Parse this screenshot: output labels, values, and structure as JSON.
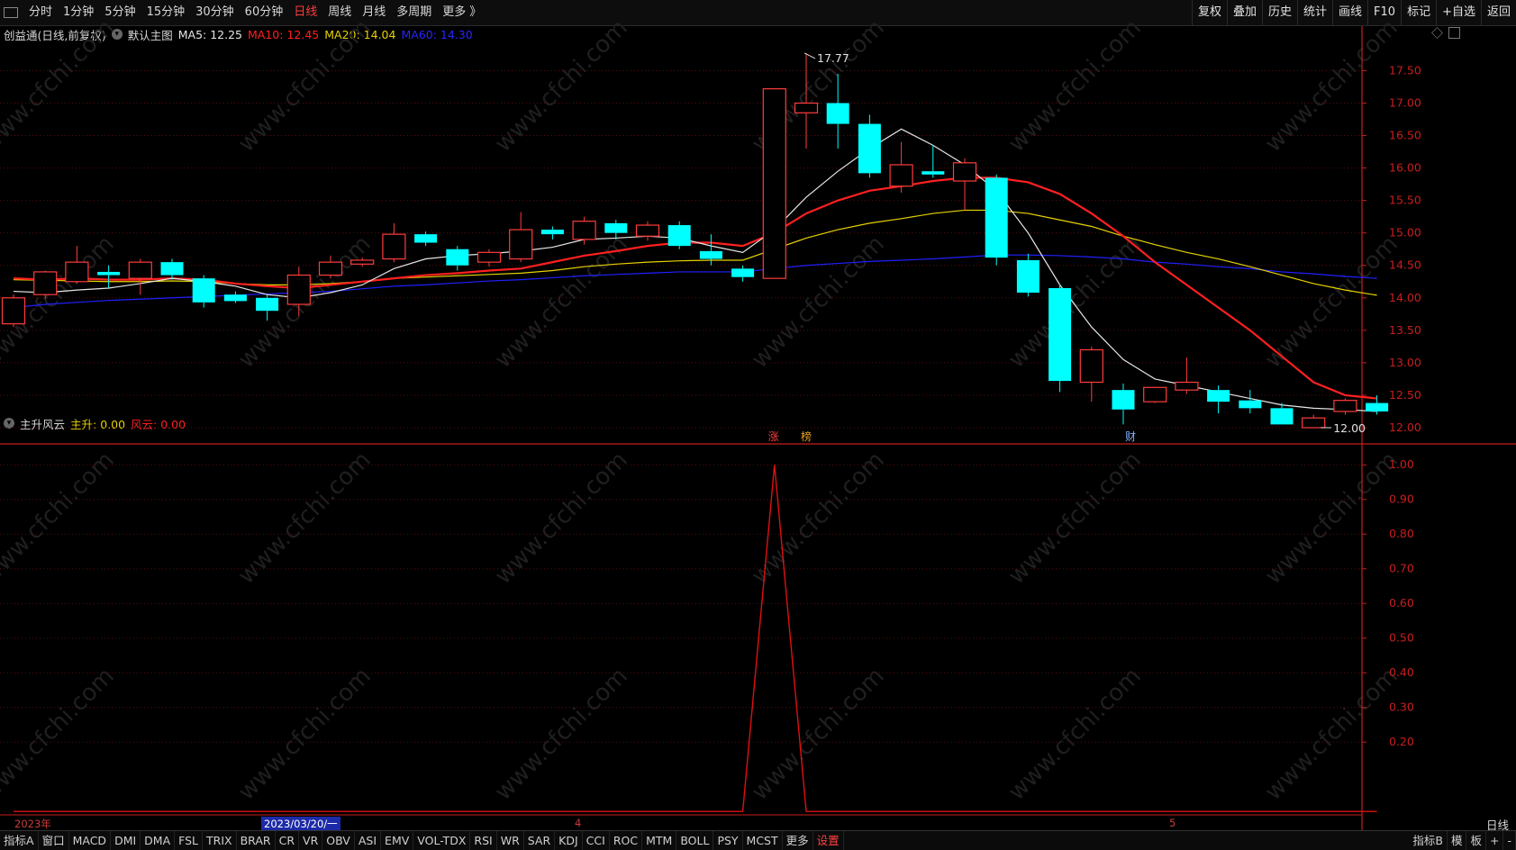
{
  "toolbar": {
    "left": [
      "分时",
      "1分钟",
      "5分钟",
      "15分钟",
      "30分钟",
      "60分钟",
      "日线",
      "周线",
      "月线",
      "多周期",
      "更多 》"
    ],
    "active": "日线",
    "right": [
      "复权",
      "叠加",
      "历史",
      "统计",
      "画线",
      "F10",
      "标记",
      "+自选",
      "返回"
    ]
  },
  "main_legend": {
    "title": "创益通(日线,前复权)",
    "template": "默认主图",
    "ma5": "MA5: 12.25",
    "ma10": "MA10: 12.45",
    "ma20": "MA20: 14.04",
    "ma60": "MA60: 14.30"
  },
  "indicator_legend": {
    "name": "主升风云",
    "s1": "主升: 0.00",
    "s2": "风云: 0.00"
  },
  "annotations": {
    "high": "17.77",
    "low": "12.00",
    "mark1": "涨",
    "mark2": "榜",
    "mark3": "财"
  },
  "dates": {
    "year": "2023年",
    "selected": "2023/03/20/一",
    "m4": "4",
    "m5": "5"
  },
  "period_label": "日线",
  "bottom": {
    "items": [
      "指标A",
      "窗口",
      "MACD",
      "DMI",
      "DMA",
      "FSL",
      "TRIX",
      "BRAR",
      "CR",
      "VR",
      "OBV",
      "ASI",
      "EMV",
      "VOL-TDX",
      "RSI",
      "WR",
      "SAR",
      "KDJ",
      "CCI",
      "ROC",
      "MTM",
      "BOLL",
      "PSY",
      "MCST",
      "更多",
      "设置"
    ],
    "right": [
      "指标B",
      "模",
      "板",
      "+",
      "-"
    ]
  },
  "watermark": "www.cfchi.com",
  "colors": {
    "up": "#ff3c3c",
    "down": "#00ffff",
    "ma5": "#e6e6e6",
    "ma10": "#ff2020",
    "ma20": "#e6d200",
    "ma60": "#2020ff",
    "axis": "#c81e1e"
  },
  "chart_data": [
    {
      "type": "candlestick",
      "title": "创益通(日线,前复权)",
      "y_ticks": [
        17.5,
        17.0,
        16.5,
        16.0,
        15.5,
        15.0,
        14.5,
        14.0,
        13.5,
        13.0,
        12.5,
        12.0
      ],
      "ylim": [
        11.75,
        17.95
      ],
      "candles": [
        {
          "o": 13.6,
          "h": 14.05,
          "l": 13.55,
          "c": 14.0
        },
        {
          "o": 14.05,
          "h": 14.42,
          "l": 13.98,
          "c": 14.4
        },
        {
          "o": 14.25,
          "h": 14.8,
          "l": 14.22,
          "c": 14.55
        },
        {
          "o": 14.4,
          "h": 14.5,
          "l": 14.15,
          "c": 14.35
        },
        {
          "o": 14.3,
          "h": 14.6,
          "l": 14.05,
          "c": 14.55
        },
        {
          "o": 14.55,
          "h": 14.6,
          "l": 14.28,
          "c": 14.35
        },
        {
          "o": 14.3,
          "h": 14.35,
          "l": 13.85,
          "c": 13.93
        },
        {
          "o": 14.05,
          "h": 14.1,
          "l": 13.92,
          "c": 13.95
        },
        {
          "o": 14.0,
          "h": 14.05,
          "l": 13.65,
          "c": 13.8
        },
        {
          "o": 13.9,
          "h": 14.48,
          "l": 13.72,
          "c": 14.35
        },
        {
          "o": 14.35,
          "h": 14.65,
          "l": 14.3,
          "c": 14.55
        },
        {
          "o": 14.52,
          "h": 14.62,
          "l": 14.48,
          "c": 14.58
        },
        {
          "o": 14.6,
          "h": 15.15,
          "l": 14.55,
          "c": 14.98
        },
        {
          "o": 14.98,
          "h": 15.02,
          "l": 14.8,
          "c": 14.85
        },
        {
          "o": 14.75,
          "h": 14.8,
          "l": 14.42,
          "c": 14.5
        },
        {
          "o": 14.55,
          "h": 14.75,
          "l": 14.48,
          "c": 14.7
        },
        {
          "o": 14.6,
          "h": 15.32,
          "l": 14.55,
          "c": 15.05
        },
        {
          "o": 15.05,
          "h": 15.1,
          "l": 14.9,
          "c": 14.98
        },
        {
          "o": 14.9,
          "h": 15.25,
          "l": 14.82,
          "c": 15.18
        },
        {
          "o": 15.15,
          "h": 15.2,
          "l": 14.9,
          "c": 15.0
        },
        {
          "o": 14.95,
          "h": 15.18,
          "l": 14.88,
          "c": 15.12
        },
        {
          "o": 15.12,
          "h": 15.18,
          "l": 14.75,
          "c": 14.8
        },
        {
          "o": 14.72,
          "h": 14.98,
          "l": 14.5,
          "c": 14.6
        },
        {
          "o": 14.45,
          "h": 14.5,
          "l": 14.25,
          "c": 14.32
        },
        {
          "o": 14.3,
          "h": 17.22,
          "l": 14.3,
          "c": 17.22
        },
        {
          "o": 16.85,
          "h": 17.77,
          "l": 16.3,
          "c": 17.0
        },
        {
          "o": 17.0,
          "h": 17.45,
          "l": 16.3,
          "c": 16.68
        },
        {
          "o": 16.68,
          "h": 16.82,
          "l": 15.85,
          "c": 15.92
        },
        {
          "o": 15.72,
          "h": 16.4,
          "l": 15.62,
          "c": 16.05
        },
        {
          "o": 15.95,
          "h": 16.35,
          "l": 15.85,
          "c": 15.9
        },
        {
          "o": 15.8,
          "h": 16.15,
          "l": 15.35,
          "c": 16.08
        },
        {
          "o": 15.85,
          "h": 15.9,
          "l": 14.5,
          "c": 14.62
        },
        {
          "o": 14.58,
          "h": 14.68,
          "l": 14.02,
          "c": 14.08
        },
        {
          "o": 14.15,
          "h": 14.2,
          "l": 12.55,
          "c": 12.72
        },
        {
          "o": 12.7,
          "h": 13.25,
          "l": 12.4,
          "c": 13.2
        },
        {
          "o": 12.58,
          "h": 12.68,
          "l": 12.05,
          "c": 12.28
        },
        {
          "o": 12.4,
          "h": 12.62,
          "l": 12.38,
          "c": 12.62
        },
        {
          "o": 12.58,
          "h": 13.08,
          "l": 12.52,
          "c": 12.7
        },
        {
          "o": 12.58,
          "h": 12.65,
          "l": 12.22,
          "c": 12.4
        },
        {
          "o": 12.42,
          "h": 12.58,
          "l": 12.22,
          "c": 12.3
        },
        {
          "o": 12.3,
          "h": 12.38,
          "l": 12.05,
          "c": 12.05
        },
        {
          "o": 12.0,
          "h": 12.2,
          "l": 12.0,
          "c": 12.15
        },
        {
          "o": 12.25,
          "h": 12.45,
          "l": 12.2,
          "c": 12.42
        },
        {
          "o": 12.38,
          "h": 12.5,
          "l": 12.2,
          "c": 12.25
        }
      ],
      "ma5": [
        14.1,
        14.08,
        14.12,
        14.15,
        14.22,
        14.3,
        14.25,
        14.18,
        14.05,
        14.0,
        14.08,
        14.2,
        14.45,
        14.6,
        14.65,
        14.68,
        14.72,
        14.78,
        14.9,
        14.92,
        14.95,
        14.92,
        14.8,
        14.7,
        15.05,
        15.55,
        15.95,
        16.3,
        16.6,
        16.35,
        16.05,
        15.65,
        15.0,
        14.2,
        13.55,
        13.05,
        12.75,
        12.65,
        12.55,
        12.45,
        12.35,
        12.3,
        12.28,
        12.25
      ],
      "ma10": [
        14.3,
        14.28,
        14.3,
        14.28,
        14.28,
        14.3,
        14.28,
        14.22,
        14.18,
        14.15,
        14.2,
        14.25,
        14.3,
        14.35,
        14.38,
        14.42,
        14.45,
        14.55,
        14.65,
        14.72,
        14.8,
        14.85,
        14.85,
        14.8,
        15.0,
        15.3,
        15.5,
        15.65,
        15.72,
        15.8,
        15.85,
        15.85,
        15.78,
        15.6,
        15.3,
        14.95,
        14.55,
        14.2,
        13.85,
        13.5,
        13.1,
        12.7,
        12.5,
        12.45
      ],
      "ma20": [
        14.28,
        14.27,
        14.26,
        14.25,
        14.25,
        14.26,
        14.25,
        14.22,
        14.2,
        14.2,
        14.22,
        14.25,
        14.3,
        14.32,
        14.34,
        14.36,
        14.38,
        14.42,
        14.48,
        14.52,
        14.55,
        14.57,
        14.58,
        14.58,
        14.75,
        14.92,
        15.05,
        15.15,
        15.22,
        15.3,
        15.35,
        15.35,
        15.3,
        15.2,
        15.1,
        14.95,
        14.82,
        14.7,
        14.6,
        14.48,
        14.35,
        14.22,
        14.12,
        14.04
      ],
      "ma60": [
        13.85,
        13.9,
        13.93,
        13.96,
        13.98,
        14.0,
        14.02,
        14.04,
        14.06,
        14.08,
        14.1,
        14.14,
        14.18,
        14.2,
        14.23,
        14.26,
        14.28,
        14.31,
        14.34,
        14.36,
        14.38,
        14.4,
        14.4,
        14.4,
        14.45,
        14.5,
        14.53,
        14.56,
        14.58,
        14.6,
        14.63,
        14.66,
        14.66,
        14.65,
        14.63,
        14.6,
        14.55,
        14.52,
        14.48,
        14.45,
        14.4,
        14.37,
        14.33,
        14.3
      ]
    },
    {
      "type": "line",
      "title": "主升风云",
      "y_ticks": [
        1.0,
        0.9,
        0.8,
        0.7,
        0.6,
        0.5,
        0.4,
        0.3,
        0.2
      ],
      "ylim": [
        -0.01,
        1.05
      ],
      "series": [
        {
          "name": "风云",
          "values": [
            0,
            0,
            0,
            0,
            0,
            0,
            0,
            0,
            0,
            0,
            0,
            0,
            0,
            0,
            0,
            0,
            0,
            0,
            0,
            0,
            0,
            0,
            0,
            0,
            1,
            0,
            0,
            0,
            0,
            0,
            0,
            0,
            0,
            0,
            0,
            0,
            0,
            0,
            0,
            0,
            0,
            0,
            0,
            0
          ]
        }
      ]
    }
  ]
}
